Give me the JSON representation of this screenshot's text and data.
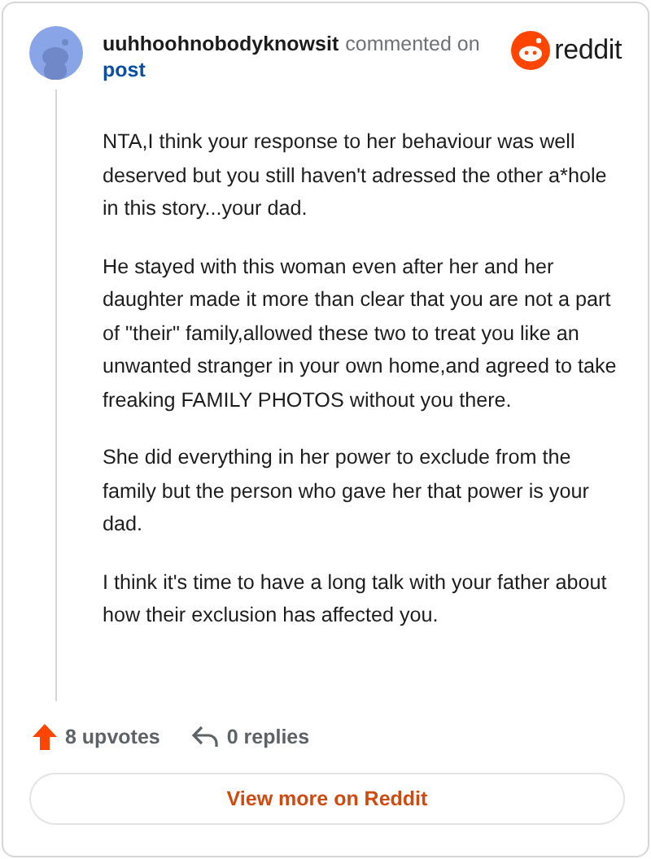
{
  "comment": {
    "author": "uuhhoohnobodyknowsit",
    "action": "commented on",
    "target": "post"
  },
  "brand": {
    "wordmark": "reddit"
  },
  "paragraphs": [
    "NTA,I think your response to her behaviour was well deserved but you still haven't adressed the other a*hole in this story...your dad.",
    "He stayed with this woman even after her and her daughter made it more than clear that you are not a part of \"their\" family,allowed these two to treat you like an unwanted stranger in your own home,and agreed to take freaking FAMILY PHOTOS without you there.",
    "She did everything in her power to exclude from the family but the person who gave her that power is your dad.",
    "I think it's time to have a long talk with your father about how their exclusion has affected you."
  ],
  "stats": {
    "upvotes": "8 upvotes",
    "replies": "0 replies"
  },
  "button": "View more on Reddit"
}
